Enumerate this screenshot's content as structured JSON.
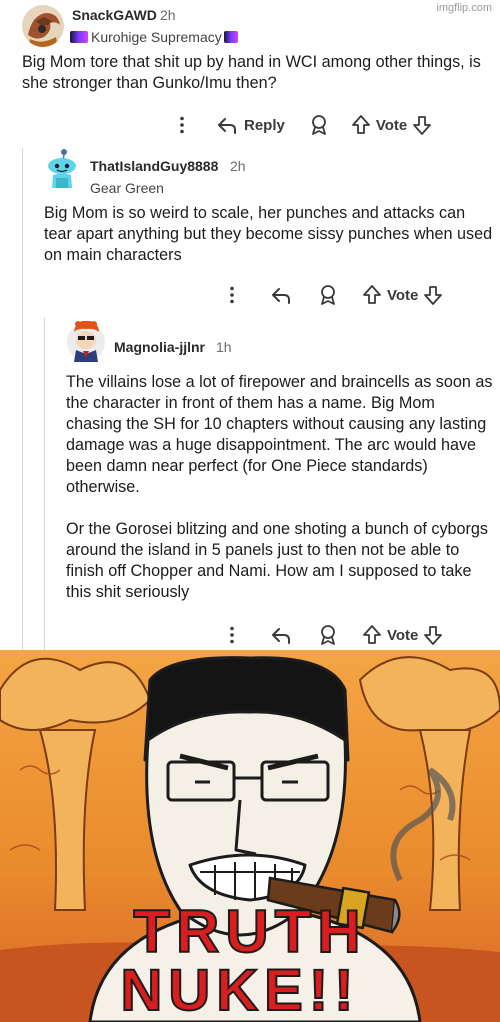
{
  "watermark": "imgflip.com",
  "comments": [
    {
      "username": "SnackGAWD",
      "time": "2h",
      "flair": "Kurohige Supremacy",
      "body": [
        "Big Mom tore that shit up by hand in WCI among other things, is she stronger than Gunko/Imu then?"
      ],
      "actions": {
        "reply": "Reply",
        "vote": "Vote"
      }
    },
    {
      "username": "ThatIslandGuy8888",
      "time": "2h",
      "flair": "Gear Green",
      "body": [
        "Big Mom is so weird to scale, her punches and attacks can tear apart anything but they become sissy punches when used on main characters"
      ],
      "actions": {
        "vote": "Vote"
      }
    },
    {
      "username": "Magnolia-jjlnr",
      "time": "1h",
      "flair": "",
      "body": [
        "The villains lose a lot of firepower and braincells as soon as the character in front of them has a name. Big Mom chasing the SH for 10 chapters without causing any lasting damage was a huge disappointment. The arc would have been damn near perfect (for One Piece standards) otherwise.",
        "Or the Gorosei blitzing and one shoting a bunch of cyborgs around the island in 5 panels just to then not be able to finish off Chopper and Nami. How am I supposed to take this shit seriously"
      ],
      "actions": {
        "vote": "Vote"
      }
    }
  ],
  "meme": {
    "line1": "TRUTH",
    "line2": "NUKE!!",
    "text_color": "#d81e1e",
    "sky_color": "#e98a2c"
  }
}
